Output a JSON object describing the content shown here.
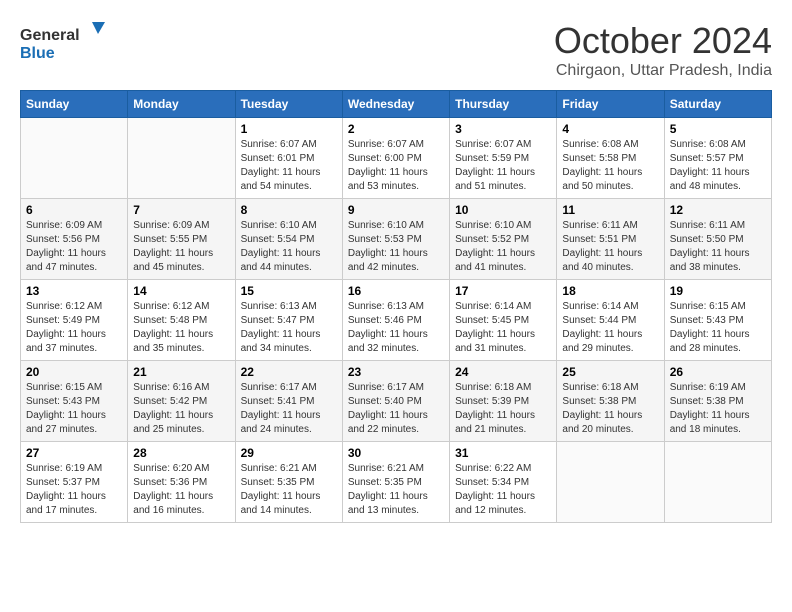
{
  "logo": {
    "line1": "General",
    "line2": "Blue"
  },
  "title": "October 2024",
  "subtitle": "Chirgaon, Uttar Pradesh, India",
  "days_of_week": [
    "Sunday",
    "Monday",
    "Tuesday",
    "Wednesday",
    "Thursday",
    "Friday",
    "Saturday"
  ],
  "weeks": [
    [
      {
        "day": "",
        "sunrise": "",
        "sunset": "",
        "daylight": ""
      },
      {
        "day": "",
        "sunrise": "",
        "sunset": "",
        "daylight": ""
      },
      {
        "day": "1",
        "sunrise": "Sunrise: 6:07 AM",
        "sunset": "Sunset: 6:01 PM",
        "daylight": "Daylight: 11 hours and 54 minutes."
      },
      {
        "day": "2",
        "sunrise": "Sunrise: 6:07 AM",
        "sunset": "Sunset: 6:00 PM",
        "daylight": "Daylight: 11 hours and 53 minutes."
      },
      {
        "day": "3",
        "sunrise": "Sunrise: 6:07 AM",
        "sunset": "Sunset: 5:59 PM",
        "daylight": "Daylight: 11 hours and 51 minutes."
      },
      {
        "day": "4",
        "sunrise": "Sunrise: 6:08 AM",
        "sunset": "Sunset: 5:58 PM",
        "daylight": "Daylight: 11 hours and 50 minutes."
      },
      {
        "day": "5",
        "sunrise": "Sunrise: 6:08 AM",
        "sunset": "Sunset: 5:57 PM",
        "daylight": "Daylight: 11 hours and 48 minutes."
      }
    ],
    [
      {
        "day": "6",
        "sunrise": "Sunrise: 6:09 AM",
        "sunset": "Sunset: 5:56 PM",
        "daylight": "Daylight: 11 hours and 47 minutes."
      },
      {
        "day": "7",
        "sunrise": "Sunrise: 6:09 AM",
        "sunset": "Sunset: 5:55 PM",
        "daylight": "Daylight: 11 hours and 45 minutes."
      },
      {
        "day": "8",
        "sunrise": "Sunrise: 6:10 AM",
        "sunset": "Sunset: 5:54 PM",
        "daylight": "Daylight: 11 hours and 44 minutes."
      },
      {
        "day": "9",
        "sunrise": "Sunrise: 6:10 AM",
        "sunset": "Sunset: 5:53 PM",
        "daylight": "Daylight: 11 hours and 42 minutes."
      },
      {
        "day": "10",
        "sunrise": "Sunrise: 6:10 AM",
        "sunset": "Sunset: 5:52 PM",
        "daylight": "Daylight: 11 hours and 41 minutes."
      },
      {
        "day": "11",
        "sunrise": "Sunrise: 6:11 AM",
        "sunset": "Sunset: 5:51 PM",
        "daylight": "Daylight: 11 hours and 40 minutes."
      },
      {
        "day": "12",
        "sunrise": "Sunrise: 6:11 AM",
        "sunset": "Sunset: 5:50 PM",
        "daylight": "Daylight: 11 hours and 38 minutes."
      }
    ],
    [
      {
        "day": "13",
        "sunrise": "Sunrise: 6:12 AM",
        "sunset": "Sunset: 5:49 PM",
        "daylight": "Daylight: 11 hours and 37 minutes."
      },
      {
        "day": "14",
        "sunrise": "Sunrise: 6:12 AM",
        "sunset": "Sunset: 5:48 PM",
        "daylight": "Daylight: 11 hours and 35 minutes."
      },
      {
        "day": "15",
        "sunrise": "Sunrise: 6:13 AM",
        "sunset": "Sunset: 5:47 PM",
        "daylight": "Daylight: 11 hours and 34 minutes."
      },
      {
        "day": "16",
        "sunrise": "Sunrise: 6:13 AM",
        "sunset": "Sunset: 5:46 PM",
        "daylight": "Daylight: 11 hours and 32 minutes."
      },
      {
        "day": "17",
        "sunrise": "Sunrise: 6:14 AM",
        "sunset": "Sunset: 5:45 PM",
        "daylight": "Daylight: 11 hours and 31 minutes."
      },
      {
        "day": "18",
        "sunrise": "Sunrise: 6:14 AM",
        "sunset": "Sunset: 5:44 PM",
        "daylight": "Daylight: 11 hours and 29 minutes."
      },
      {
        "day": "19",
        "sunrise": "Sunrise: 6:15 AM",
        "sunset": "Sunset: 5:43 PM",
        "daylight": "Daylight: 11 hours and 28 minutes."
      }
    ],
    [
      {
        "day": "20",
        "sunrise": "Sunrise: 6:15 AM",
        "sunset": "Sunset: 5:43 PM",
        "daylight": "Daylight: 11 hours and 27 minutes."
      },
      {
        "day": "21",
        "sunrise": "Sunrise: 6:16 AM",
        "sunset": "Sunset: 5:42 PM",
        "daylight": "Daylight: 11 hours and 25 minutes."
      },
      {
        "day": "22",
        "sunrise": "Sunrise: 6:17 AM",
        "sunset": "Sunset: 5:41 PM",
        "daylight": "Daylight: 11 hours and 24 minutes."
      },
      {
        "day": "23",
        "sunrise": "Sunrise: 6:17 AM",
        "sunset": "Sunset: 5:40 PM",
        "daylight": "Daylight: 11 hours and 22 minutes."
      },
      {
        "day": "24",
        "sunrise": "Sunrise: 6:18 AM",
        "sunset": "Sunset: 5:39 PM",
        "daylight": "Daylight: 11 hours and 21 minutes."
      },
      {
        "day": "25",
        "sunrise": "Sunrise: 6:18 AM",
        "sunset": "Sunset: 5:38 PM",
        "daylight": "Daylight: 11 hours and 20 minutes."
      },
      {
        "day": "26",
        "sunrise": "Sunrise: 6:19 AM",
        "sunset": "Sunset: 5:38 PM",
        "daylight": "Daylight: 11 hours and 18 minutes."
      }
    ],
    [
      {
        "day": "27",
        "sunrise": "Sunrise: 6:19 AM",
        "sunset": "Sunset: 5:37 PM",
        "daylight": "Daylight: 11 hours and 17 minutes."
      },
      {
        "day": "28",
        "sunrise": "Sunrise: 6:20 AM",
        "sunset": "Sunset: 5:36 PM",
        "daylight": "Daylight: 11 hours and 16 minutes."
      },
      {
        "day": "29",
        "sunrise": "Sunrise: 6:21 AM",
        "sunset": "Sunset: 5:35 PM",
        "daylight": "Daylight: 11 hours and 14 minutes."
      },
      {
        "day": "30",
        "sunrise": "Sunrise: 6:21 AM",
        "sunset": "Sunset: 5:35 PM",
        "daylight": "Daylight: 11 hours and 13 minutes."
      },
      {
        "day": "31",
        "sunrise": "Sunrise: 6:22 AM",
        "sunset": "Sunset: 5:34 PM",
        "daylight": "Daylight: 11 hours and 12 minutes."
      },
      {
        "day": "",
        "sunrise": "",
        "sunset": "",
        "daylight": ""
      },
      {
        "day": "",
        "sunrise": "",
        "sunset": "",
        "daylight": ""
      }
    ]
  ]
}
